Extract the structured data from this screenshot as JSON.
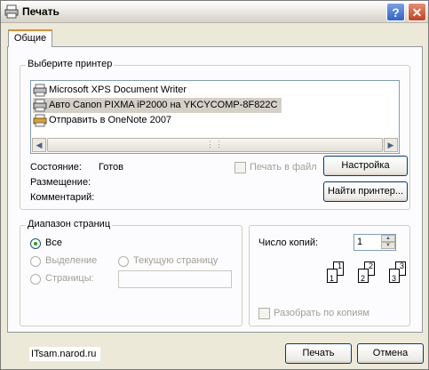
{
  "window": {
    "title": "Печать"
  },
  "title_buttons": {
    "help": "?",
    "close": "✕"
  },
  "tab": {
    "label": "Общие"
  },
  "printer_group": {
    "title": "Выберите принтер",
    "printers": [
      {
        "name": "Microsoft XPS Document Writer",
        "icon": "printer-icon",
        "selected": false
      },
      {
        "name": "Авто Canon PIXMA iP2000 на YKCYCOMP-8F822C",
        "icon": "printer-icon",
        "selected": true
      },
      {
        "name": "Отправить в OneNote 2007",
        "icon": "printer-icon",
        "selected": false
      }
    ],
    "status_label": "Состояние:",
    "status_value": "Готов",
    "location_label": "Размещение:",
    "comment_label": "Комментарий:",
    "print_to_file": "Печать в файл",
    "setup_button": "Настройка",
    "find_button": "Найти принтер..."
  },
  "range_group": {
    "title": "Диапазон страниц",
    "all": "Все",
    "selection": "Выделение",
    "current_page": "Текущую страницу",
    "pages": "Страницы:"
  },
  "copies_group": {
    "copies_label": "Число копий:",
    "copies_value": "1",
    "collate": "Разобрать по копиям",
    "collate_pages": [
      "1",
      "1",
      "2",
      "2",
      "3",
      "3"
    ]
  },
  "footer": {
    "watermark": "ITsam.narod.ru",
    "print_button": "Печать",
    "cancel_button": "Отмена"
  }
}
